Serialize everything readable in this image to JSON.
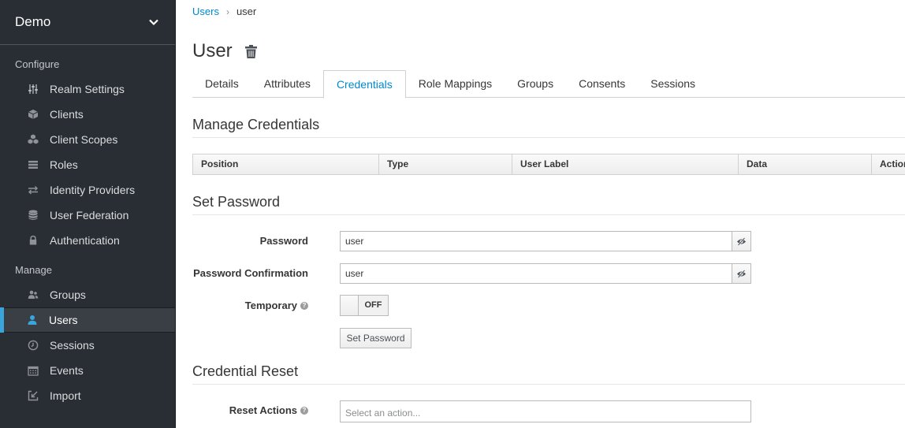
{
  "sidebar": {
    "realm": "Demo",
    "configure_label": "Configure",
    "manage_label": "Manage",
    "configure_items": [
      {
        "label": "Realm Settings",
        "icon": "sliders-icon"
      },
      {
        "label": "Clients",
        "icon": "cube-icon"
      },
      {
        "label": "Client Scopes",
        "icon": "cubes-icon"
      },
      {
        "label": "Roles",
        "icon": "list-icon"
      },
      {
        "label": "Identity Providers",
        "icon": "exchange-icon"
      },
      {
        "label": "User Federation",
        "icon": "database-icon"
      },
      {
        "label": "Authentication",
        "icon": "lock-icon"
      }
    ],
    "manage_items": [
      {
        "label": "Groups",
        "icon": "users-icon"
      },
      {
        "label": "Users",
        "icon": "user-icon",
        "active": true
      },
      {
        "label": "Sessions",
        "icon": "clock-icon"
      },
      {
        "label": "Events",
        "icon": "calendar-icon"
      },
      {
        "label": "Import",
        "icon": "import-icon"
      }
    ]
  },
  "breadcrumb": {
    "parent": "Users",
    "current": "user"
  },
  "page": {
    "title": "User"
  },
  "tabs": [
    "Details",
    "Attributes",
    "Credentials",
    "Role Mappings",
    "Groups",
    "Consents",
    "Sessions"
  ],
  "active_tab": "Credentials",
  "manage_credentials": {
    "heading": "Manage Credentials",
    "columns": [
      "Position",
      "Type",
      "User Label",
      "Data",
      "Actions"
    ]
  },
  "set_password": {
    "heading": "Set Password",
    "password_label": "Password",
    "password_value": "user",
    "confirm_label": "Password Confirmation",
    "confirm_value": "user",
    "temporary_label": "Temporary",
    "temporary_state": "OFF",
    "button_label": "Set Password"
  },
  "credential_reset": {
    "heading": "Credential Reset",
    "reset_label": "Reset Actions",
    "reset_placeholder": "Select an action..."
  },
  "colors": {
    "sidebar_bg": "#292e34",
    "accent": "#0088ce",
    "active_bar": "#39a5dc"
  }
}
